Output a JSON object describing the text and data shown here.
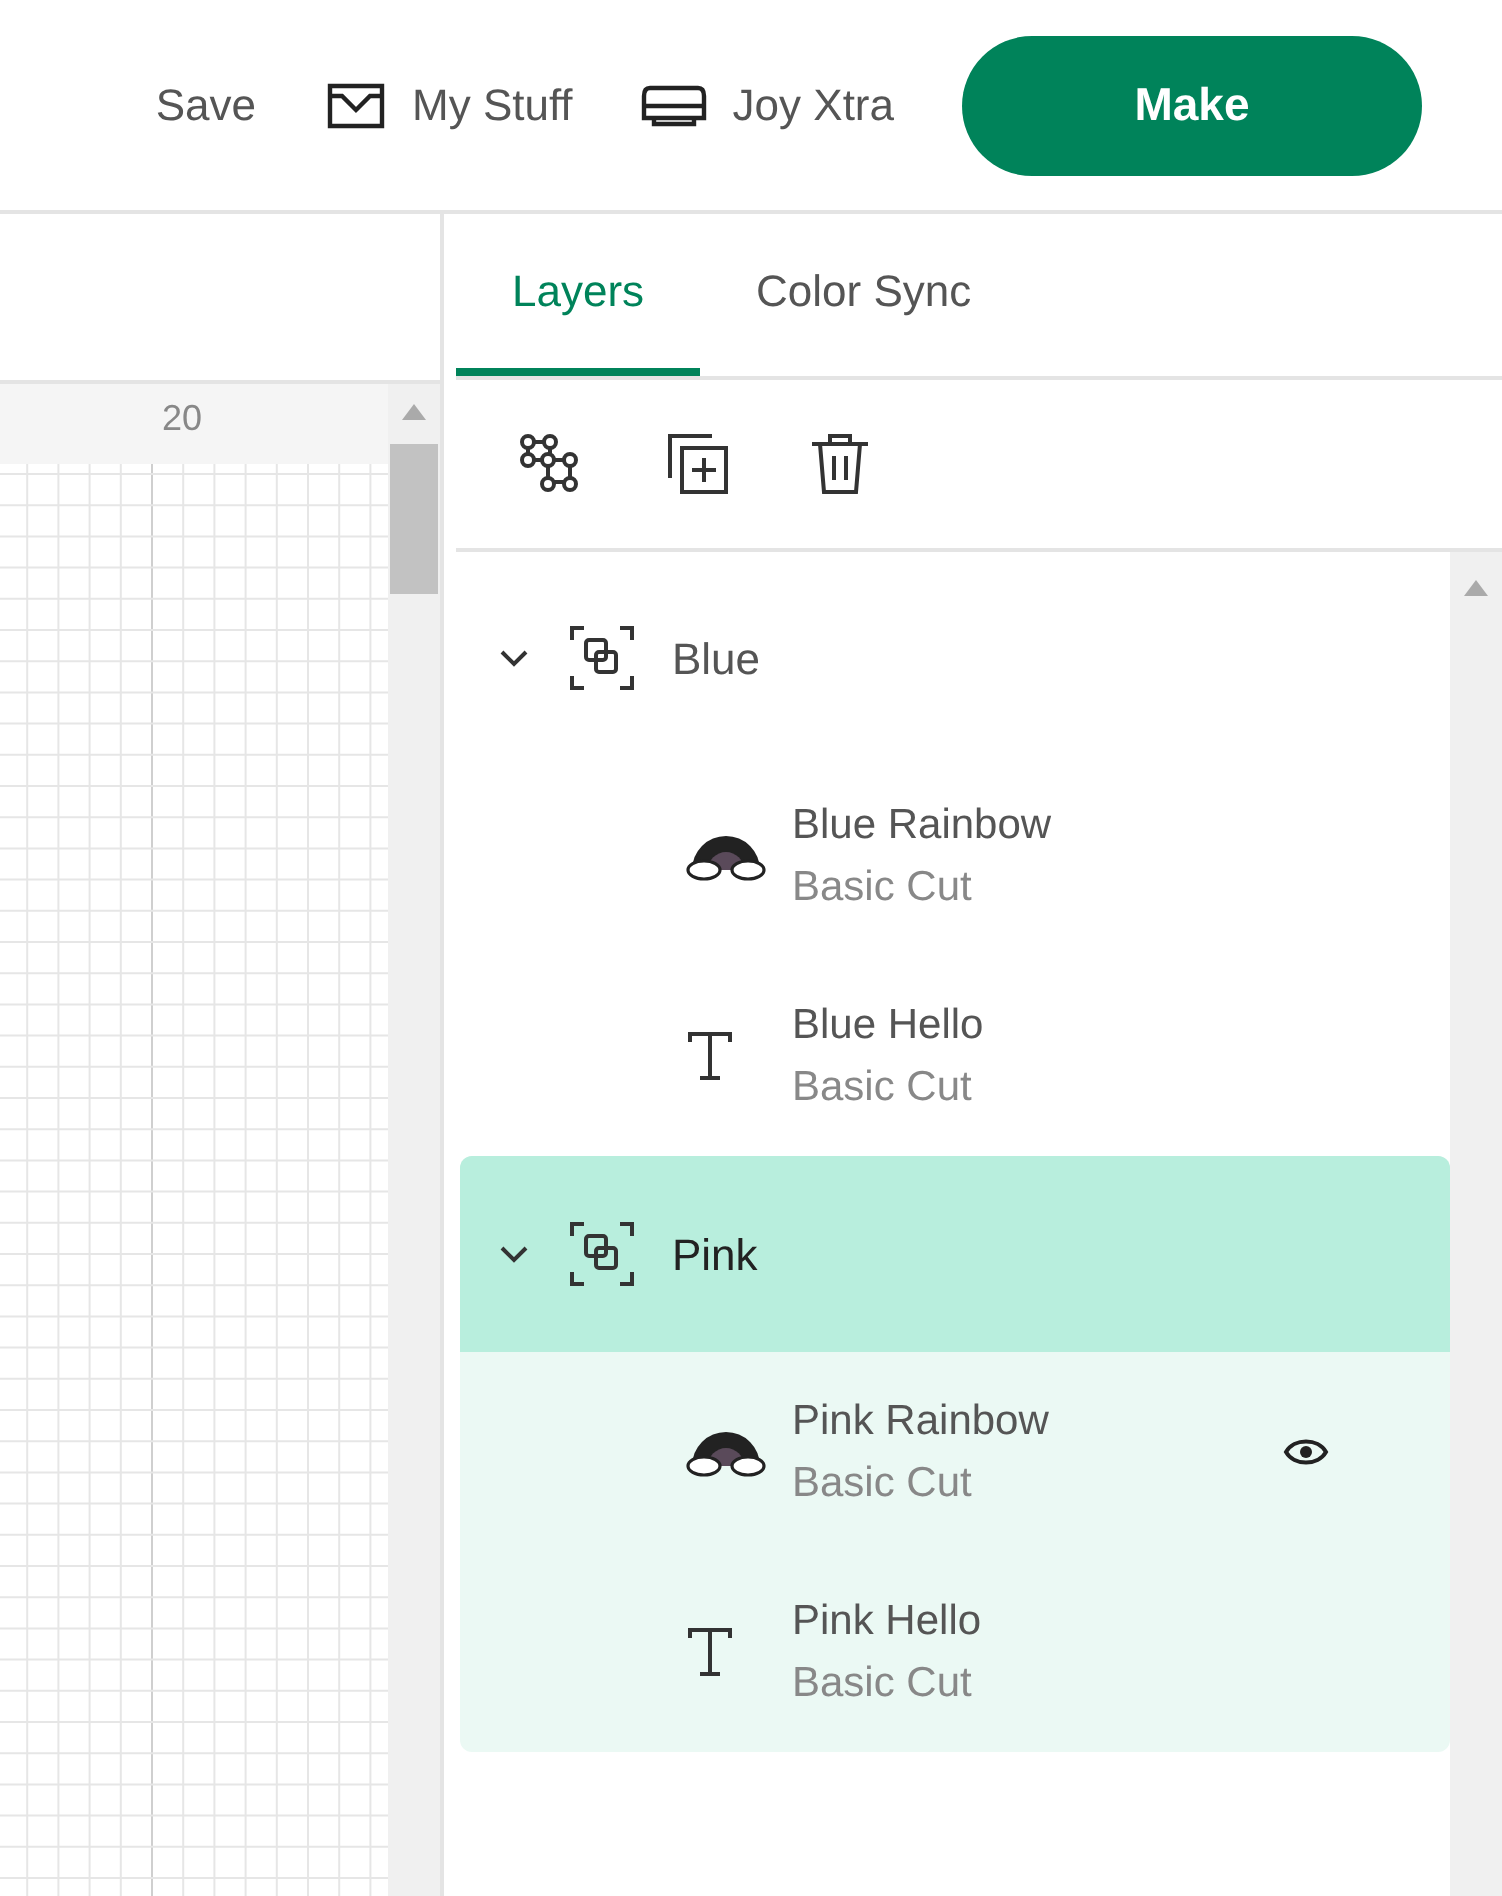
{
  "header": {
    "save": "Save",
    "my_stuff": "My Stuff",
    "machine": "Joy Xtra",
    "make": "Make"
  },
  "canvas": {
    "ruler_label": "20"
  },
  "tabs": [
    {
      "label": "Layers",
      "selected": true
    },
    {
      "label": "Color Sync",
      "selected": false
    }
  ],
  "layers": [
    {
      "name": "Blue",
      "expanded": true,
      "selected": false,
      "children": [
        {
          "kind": "image",
          "name": "Blue Rainbow",
          "operation": "Basic Cut",
          "hovered": false
        },
        {
          "kind": "text",
          "name": "Blue Hello",
          "operation": "Basic Cut",
          "hovered": false
        }
      ]
    },
    {
      "name": "Pink",
      "expanded": true,
      "selected": true,
      "children": [
        {
          "kind": "image",
          "name": "Pink Rainbow",
          "operation": "Basic Cut",
          "hovered": true
        },
        {
          "kind": "text",
          "name": "Pink Hello",
          "operation": "Basic Cut",
          "hovered": false
        }
      ]
    }
  ]
}
